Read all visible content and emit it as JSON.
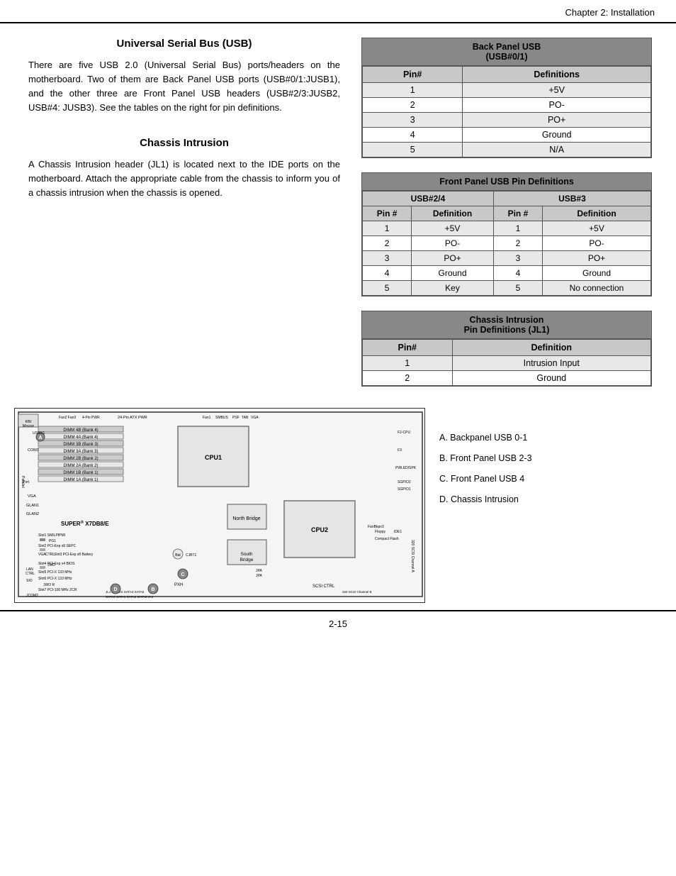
{
  "header": {
    "text": "Chapter 2: Installation"
  },
  "usb_section": {
    "title": "Universal Serial Bus (USB)",
    "body": "There are five USB 2.0 (Universal Serial Bus) ports/headers on the motherboard. Two of them are Back Panel USB ports (USB#0/1:JUSB1), and the other three are Front Panel USB headers (USB#2/3:JUSB2, USB#4: JUSB3). See the tables on the right for pin definitions."
  },
  "chassis_section": {
    "title": "Chassis Intrusion",
    "body": "A Chassis Intrusion header (JL1) is located next to the IDE ports on the motherboard.  Attach the appropriate cable from the chassis to inform you of a chassis intrusion when the chassis is opened."
  },
  "back_panel_usb_table": {
    "title1": "Back Panel USB",
    "title2": "(USB#0/1)",
    "col_pin": "Pin#",
    "col_def": "Definitions",
    "rows": [
      {
        "pin": "1",
        "def": "+5V"
      },
      {
        "pin": "2",
        "def": "PO-"
      },
      {
        "pin": "3",
        "def": "PO+"
      },
      {
        "pin": "4",
        "def": "Ground"
      },
      {
        "pin": "5",
        "def": "N/A"
      }
    ]
  },
  "front_panel_usb_table": {
    "title": "Front Panel USB Pin Definitions",
    "usb24_header": "USB#2/4",
    "usb3_header": "USB#3",
    "pin_header": "Pin #",
    "def_header": "Definition",
    "rows": [
      {
        "pin1": "1",
        "def1": "+5V",
        "pin2": "1",
        "def2": "+5V"
      },
      {
        "pin1": "2",
        "def1": "PO-",
        "pin2": "2",
        "def2": "PO-"
      },
      {
        "pin1": "3",
        "def1": "PO+",
        "pin2": "3",
        "def2": "PO+"
      },
      {
        "pin1": "4",
        "def1": "Ground",
        "pin2": "4",
        "def2": "Ground"
      },
      {
        "pin1": "5",
        "def1": "Key",
        "pin2": "5",
        "def2": "No connection"
      }
    ]
  },
  "chassis_intrusion_table": {
    "title1": "Chassis Intrusion",
    "title2": "Pin Definitions (JL1)",
    "col_pin": "Pin#",
    "col_def": "Definition",
    "rows": [
      {
        "pin": "1",
        "def": "Intrusion Input"
      },
      {
        "pin": "2",
        "def": "Ground"
      }
    ]
  },
  "legend": {
    "items": [
      "A. Backpanel USB 0-1",
      "B. Front Panel USB 2-3",
      "C. Front Panel USB 4",
      "D. Chassis Intrusion"
    ]
  },
  "footer": {
    "text": "2-15"
  }
}
